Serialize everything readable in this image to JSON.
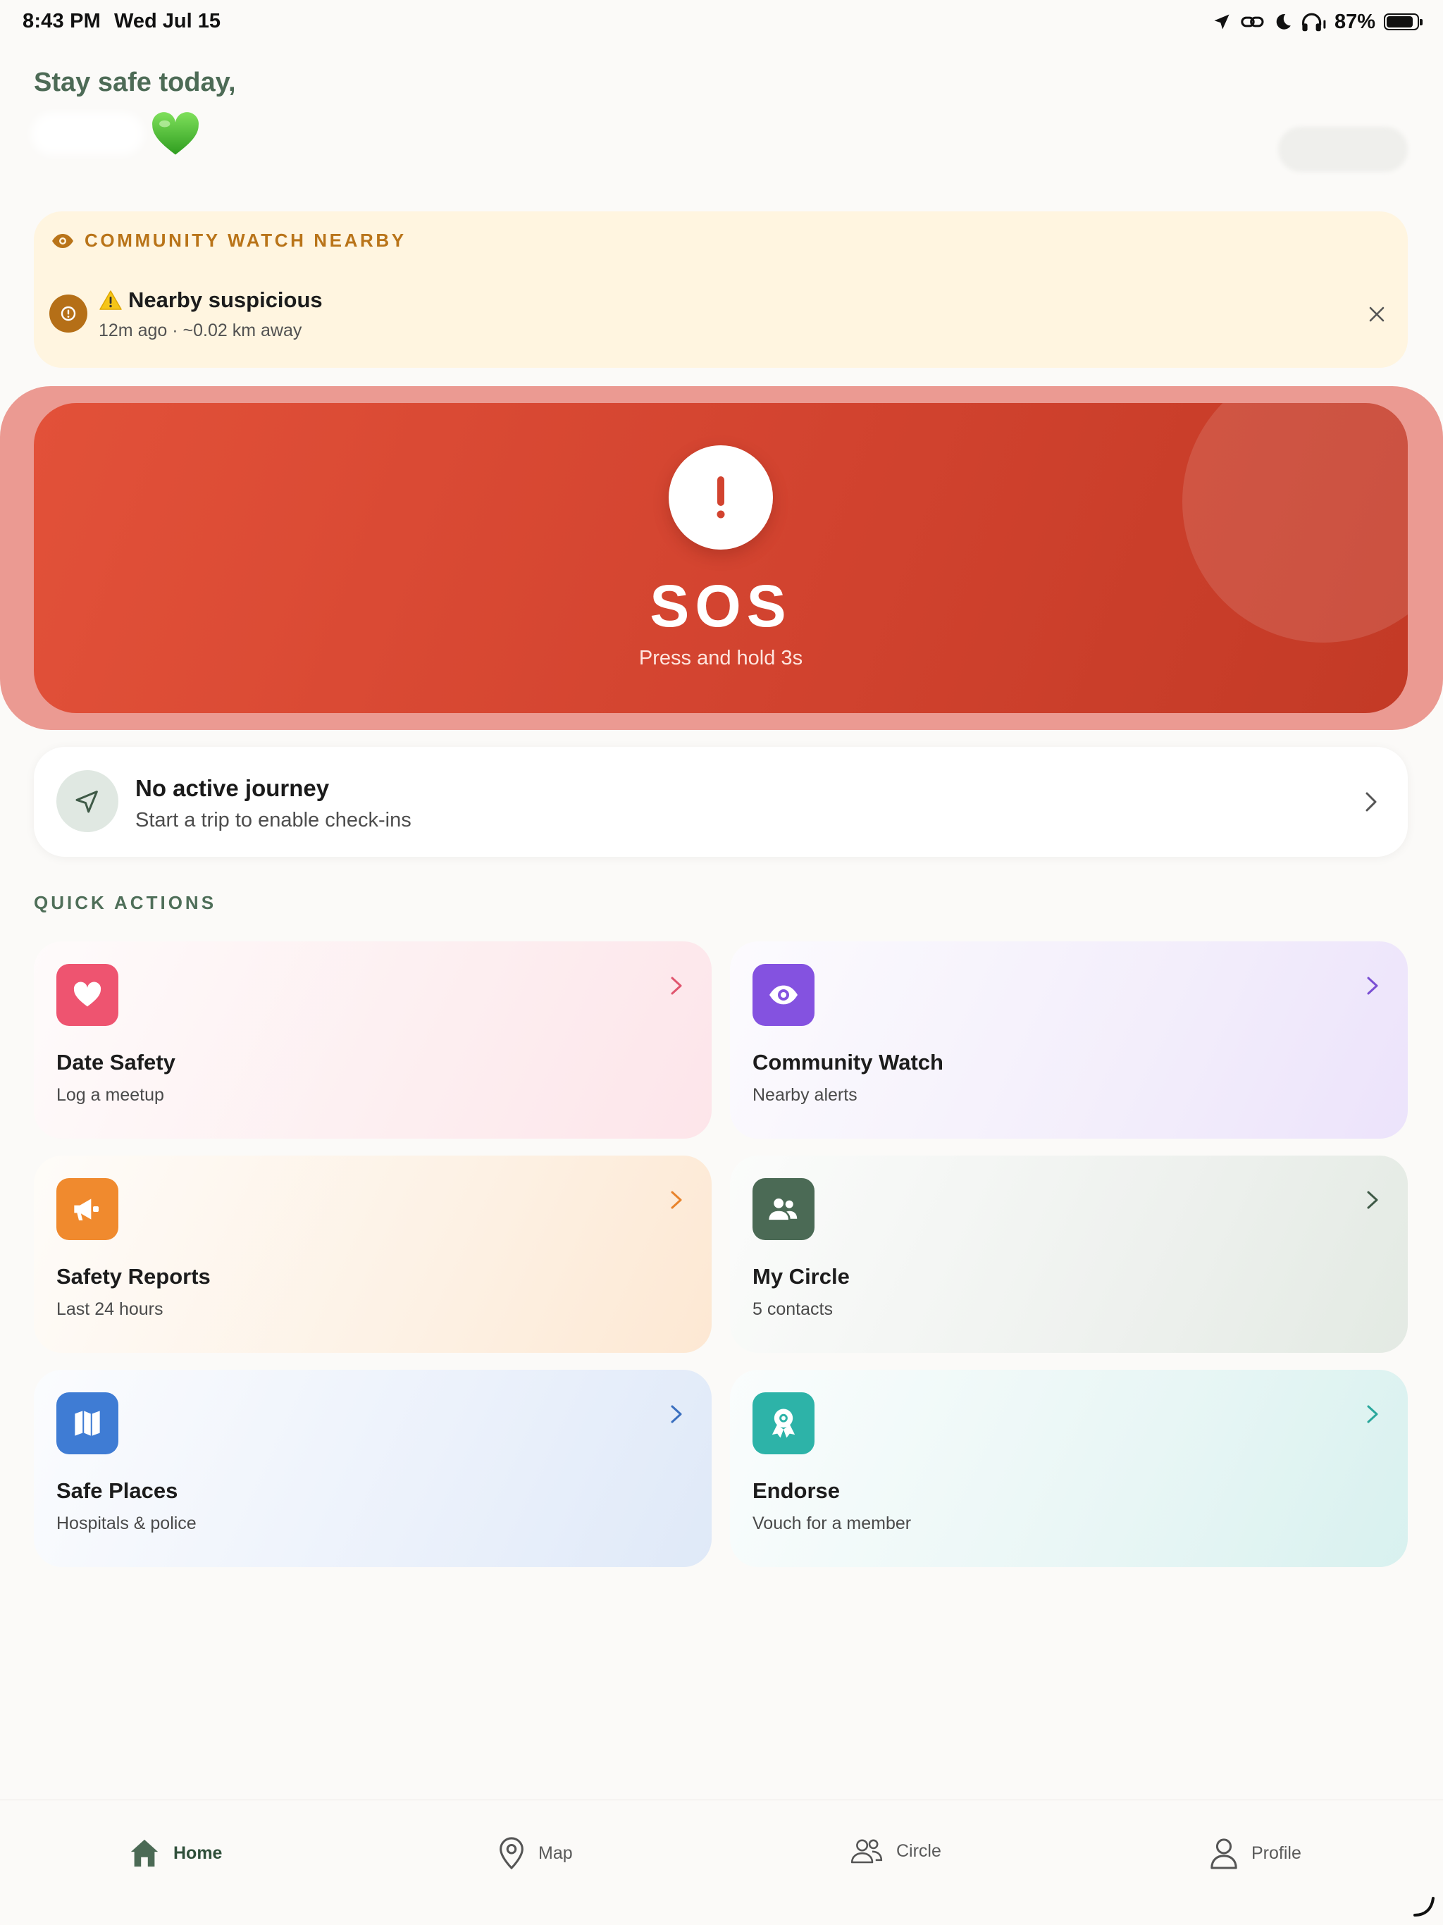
{
  "status_bar": {
    "time": "8:43 PM",
    "date": "Wed Jul 15",
    "battery": "87%",
    "battery_level": 0.87,
    "icons": [
      "location-arrow-icon",
      "link-icon",
      "moon-icon",
      "headphones-icon",
      "battery-icon"
    ]
  },
  "greeting": {
    "line1": "Stay safe today,",
    "emoji": "green-heart-icon"
  },
  "community_watch": {
    "header": "COMMUNITY WATCH NEARBY",
    "alert_title": "Nearby suspicious",
    "alert_meta": "12m ago · ~0.02 km away",
    "accent": "#b97419"
  },
  "sos": {
    "title": "SOS",
    "subtitle": "Press and hold 3s",
    "color": "#d2432f"
  },
  "journey": {
    "title": "No active journey",
    "subtitle": "Start a trip to enable check-ins"
  },
  "quick_actions": {
    "label": "QUICK ACTIONS",
    "items": [
      {
        "title": "Date Safety",
        "subtitle": "Log a meetup",
        "icon": "heart-icon",
        "color": "#ee5470"
      },
      {
        "title": "Community Watch",
        "subtitle": "Nearby alerts",
        "icon": "eye-icon",
        "color": "#8452e0"
      },
      {
        "title": "Safety Reports",
        "subtitle": "Last 24 hours",
        "icon": "megaphone-icon",
        "color": "#f08a2e"
      },
      {
        "title": "My Circle",
        "subtitle": "5 contacts",
        "icon": "people-icon",
        "color": "#4b6a55"
      },
      {
        "title": "Safe Places",
        "subtitle": "Hospitals & police",
        "icon": "map-icon",
        "color": "#3f7cd4"
      },
      {
        "title": "Endorse",
        "subtitle": "Vouch for a member",
        "icon": "award-icon",
        "color": "#2db3a8"
      }
    ]
  },
  "tabs": [
    {
      "label": "Home",
      "icon": "home-icon",
      "active": true
    },
    {
      "label": "Map",
      "icon": "map-pin-icon",
      "active": false
    },
    {
      "label": "Circle",
      "icon": "people-outline-icon",
      "active": false
    },
    {
      "label": "Profile",
      "icon": "person-icon",
      "active": false
    }
  ]
}
